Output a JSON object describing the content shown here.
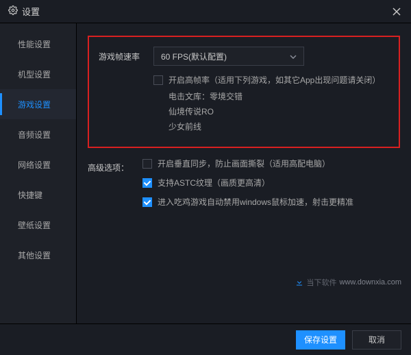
{
  "titlebar": {
    "title": "设置"
  },
  "sidebar": {
    "items": [
      {
        "label": "性能设置"
      },
      {
        "label": "机型设置"
      },
      {
        "label": "游戏设置"
      },
      {
        "label": "音频设置"
      },
      {
        "label": "网络设置"
      },
      {
        "label": "快捷键"
      },
      {
        "label": "壁纸设置"
      },
      {
        "label": "其他设置"
      }
    ],
    "active_index": 2
  },
  "main": {
    "fps": {
      "label": "游戏帧速率",
      "select_value": "60 FPS(默认配置)",
      "high_fps_checkbox": "开启高帧率（适用下列游戏，如其它App出现问题请关闭）",
      "games": [
        "电击文库：零境交错",
        "仙境传说RO",
        "少女前线"
      ]
    },
    "advanced": {
      "label": "高级选项：",
      "vsync": "开启垂直同步，防止画面撕裂（适用高配电脑）",
      "astc": "支持ASTC纹理（画质更高清）",
      "mouse": "进入吃鸡游戏自动禁用windows鼠标加速，射击更精准"
    }
  },
  "footer": {
    "save": "保存设置",
    "cancel": "取消"
  },
  "watermark": {
    "brand": "当下软件",
    "domain": "www.downxia.com"
  }
}
